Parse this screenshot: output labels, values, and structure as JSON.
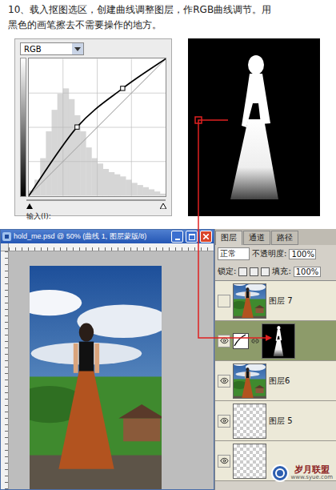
{
  "instruction": {
    "lines": [
      "10、载入抠图选区，创建曲线调整图层，作RGB曲线调节。用",
      "黑色的画笔擦去不需要操作的地方。"
    ]
  },
  "curves": {
    "channel": "RGB",
    "input_label": "输入(I):",
    "points": [
      [
        0,
        0
      ],
      [
        90,
        128
      ],
      [
        175,
        200
      ],
      [
        255,
        255
      ]
    ],
    "histogram": [
      0.05,
      0.15,
      0.35,
      0.6,
      0.8,
      0.95,
      1,
      0.9,
      0.75,
      0.6,
      0.45,
      0.35,
      0.3,
      0.25,
      0.22,
      0.2,
      0.18,
      0.15,
      0.12,
      0.1,
      0.08,
      0.06,
      0.04,
      0.02
    ]
  },
  "document": {
    "title": "hold_me.psd @ 50% (曲线 1, 图层蒙版/8)"
  },
  "layers_panel": {
    "tabs": [
      {
        "label": "图层",
        "selected": true
      },
      {
        "label": "通道",
        "selected": false
      },
      {
        "label": "路径",
        "selected": false
      }
    ],
    "blend_mode": "正常",
    "opacity_label": "不透明度:",
    "opacity": "100%",
    "lock_label": "锁定:",
    "fill_label": "填充:",
    "fill": "100%",
    "layers": [
      {
        "name": "图层 7",
        "kind": "image",
        "visible": false,
        "selected": false
      },
      {
        "name": "",
        "kind": "adjustment",
        "visible": true,
        "selected": true
      },
      {
        "name": "图层6",
        "kind": "image",
        "visible": true,
        "selected": false
      },
      {
        "name": "图层 5",
        "kind": "transparent",
        "visible": true,
        "selected": false
      },
      {
        "name": "",
        "kind": "transparent",
        "visible": true,
        "selected": false
      }
    ]
  },
  "watermark": {
    "name": "岁月联盟",
    "url": "www.syue.com"
  }
}
